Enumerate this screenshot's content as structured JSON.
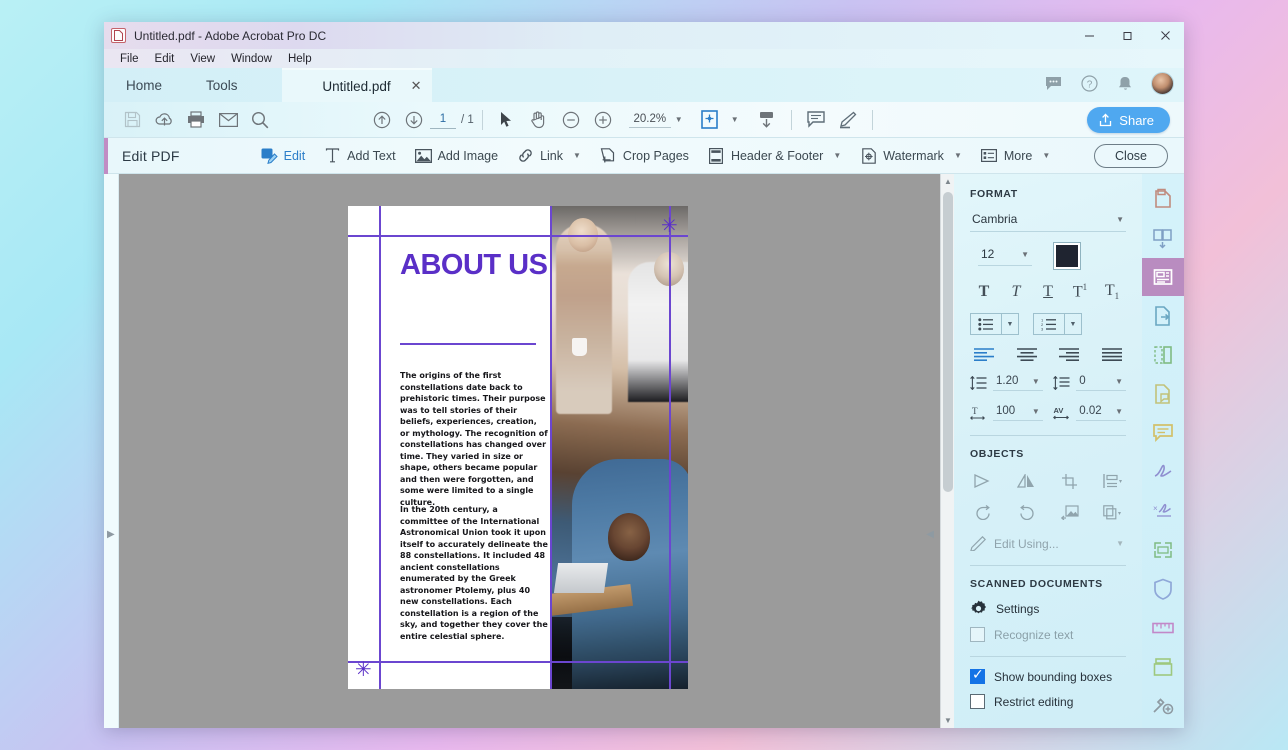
{
  "window": {
    "title": "Untitled.pdf - Adobe Acrobat Pro DC",
    "app_icon": "pdf-file-icon",
    "controls": {
      "minimize": "—",
      "maximize": "❐",
      "close": "✕"
    }
  },
  "menubar": {
    "items": [
      "File",
      "Edit",
      "View",
      "Window",
      "Help"
    ]
  },
  "tabstrip": {
    "nav_tabs": [
      "Home",
      "Tools"
    ],
    "document_tab": {
      "label": "Untitled.pdf",
      "close": "✕"
    },
    "right_icons": [
      "comment-bubble-icon",
      "help-icon",
      "bell-icon",
      "avatar"
    ]
  },
  "toolbar": {
    "left_icons": [
      "save-icon",
      "cloud-upload-icon",
      "print-icon",
      "email-icon",
      "search-icon"
    ],
    "page_prev": "previous-page-icon",
    "page_next": "next-page-icon",
    "page_current": "1",
    "page_total": "/ 1",
    "select_icon": "cursor-select-icon",
    "hand_icon": "hand-pan-icon",
    "zoom_out": "zoom-out-icon",
    "zoom_in": "zoom-in-icon",
    "zoom_value": "20.2%",
    "fit_icon": "fit-page-icon",
    "scroll_icon": "page-scroll-icon",
    "comment_icon": "comment-icon",
    "highlight_icon": "highlighter-icon",
    "share_label": "Share"
  },
  "editbar": {
    "title": "Edit PDF",
    "tools": [
      {
        "label": "Edit",
        "icon": "edit-pdf-icon",
        "caret": false,
        "active": true
      },
      {
        "label": "Add Text",
        "icon": "add-text-icon",
        "caret": false,
        "active": false
      },
      {
        "label": "Add Image",
        "icon": "add-image-icon",
        "caret": false,
        "active": false
      },
      {
        "label": "Link",
        "icon": "link-icon",
        "caret": true,
        "active": false
      },
      {
        "label": "Crop Pages",
        "icon": "crop-pages-icon",
        "caret": false,
        "active": false
      },
      {
        "label": "Header & Footer",
        "icon": "header-footer-icon",
        "caret": true,
        "active": false
      },
      {
        "label": "Watermark",
        "icon": "watermark-icon",
        "caret": true,
        "active": false
      },
      {
        "label": "More",
        "icon": "more-list-icon",
        "caret": true,
        "active": false
      }
    ],
    "close_label": "Close"
  },
  "document": {
    "heading": "ABOUT US",
    "paragraph1": "The origins of the first constellations date back to prehistoric times. Their purpose was to tell stories of their beliefs, experiences, creation, or mythology. The recognition of constellations has changed over time. They varied in size or shape, others became popular and then were forgotten, and some were limited to a single culture.",
    "paragraph2": "In the 20th century, a committee of the International Astronomical Union took it upon itself to accurately delineate the 88 constellations. It included 48 ancient constellations enumerated by the Greek astronomer Ptolemy, plus 40 new constellations. Each constellation is a region of the sky, and together they cover the entire celestial sphere.",
    "heading_color": "#5a2fc7",
    "guide_color": "#6b46d0",
    "guide_marker": "✳"
  },
  "format_panel": {
    "section_title": "FORMAT",
    "font_family": "Cambria",
    "font_size": "12",
    "font_color": "#1f2430",
    "style_buttons": [
      {
        "name": "bold",
        "glyph": "T"
      },
      {
        "name": "italic",
        "glyph": "T"
      },
      {
        "name": "underline",
        "glyph": "T"
      },
      {
        "name": "superscript",
        "glyph": "T"
      },
      {
        "name": "subscript",
        "glyph": "T"
      }
    ],
    "list_buttons": [
      "bulleted-list",
      "numbered-list"
    ],
    "align_buttons": [
      "align-left",
      "align-center",
      "align-right",
      "align-justify"
    ],
    "line_spacing": "1.20",
    "paragraph_spacing": "0",
    "horizontal_scale": "100",
    "character_spacing": "0.02"
  },
  "objects_panel": {
    "section_title": "OBJECTS",
    "row1": [
      "flip-vertical-icon",
      "flip-horizontal-icon",
      "crop-image-icon",
      "align-objects-icon"
    ],
    "row2": [
      "rotate-counterclockwise-icon",
      "rotate-clockwise-icon",
      "replace-image-icon",
      "arrange-icon"
    ],
    "edit_using_label": "Edit Using..."
  },
  "scanned_panel": {
    "section_title": "SCANNED DOCUMENTS",
    "settings_label": "Settings",
    "recognize_text_label": "Recognize text",
    "recognize_text_checked": false,
    "show_bounding_boxes_label": "Show bounding boxes",
    "show_bounding_boxes_checked": true,
    "restrict_editing_label": "Restrict editing",
    "restrict_editing_checked": false
  },
  "icon_rail": {
    "items": [
      {
        "name": "export-pdf-icon",
        "color": "#c08b7e",
        "selected": false
      },
      {
        "name": "organize-pages-icon",
        "color": "#7f9fc4",
        "selected": false
      },
      {
        "name": "edit-pdf-icon",
        "color": "#ffffff",
        "selected": true
      },
      {
        "name": "create-pdf-icon",
        "color": "#6aa7c2",
        "selected": false
      },
      {
        "name": "combine-files-icon",
        "color": "#7fbb83",
        "selected": false
      },
      {
        "name": "comment-pdf-icon",
        "color": "#c2c27a",
        "selected": false
      },
      {
        "name": "comment-bubble-icon",
        "color": "#d2c06a",
        "selected": false
      },
      {
        "name": "fill-sign-icon",
        "color": "#8f8fd0",
        "selected": false
      },
      {
        "name": "request-signature-icon",
        "color": "#8f8fd0",
        "selected": false
      },
      {
        "name": "scan-ocr-icon",
        "color": "#7fbb83",
        "selected": false
      },
      {
        "name": "protect-icon",
        "color": "#8fa8d8",
        "selected": false
      },
      {
        "name": "measure-icon",
        "color": "#c288c8",
        "selected": false
      },
      {
        "name": "print-production-icon",
        "color": "#9ec87f",
        "selected": false
      },
      {
        "name": "pdf-standards-icon",
        "color": "#8e9aa2",
        "selected": false
      }
    ]
  }
}
